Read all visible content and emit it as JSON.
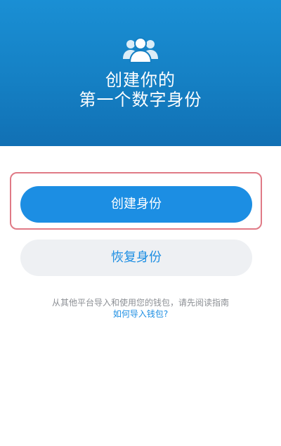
{
  "header": {
    "icon": "users-icon",
    "title_line1": "创建你的",
    "title_line2": "第一个数字身份",
    "background_color": "#1580c4"
  },
  "actions": {
    "create_label": "创建身份",
    "restore_label": "恢复身份",
    "highlight_color": "#e07a86",
    "primary_color": "#1c8ee3"
  },
  "import_hint": {
    "text": "从其他平台导入和使用您的钱包，请先阅读指南",
    "link": "如何导入钱包?"
  }
}
